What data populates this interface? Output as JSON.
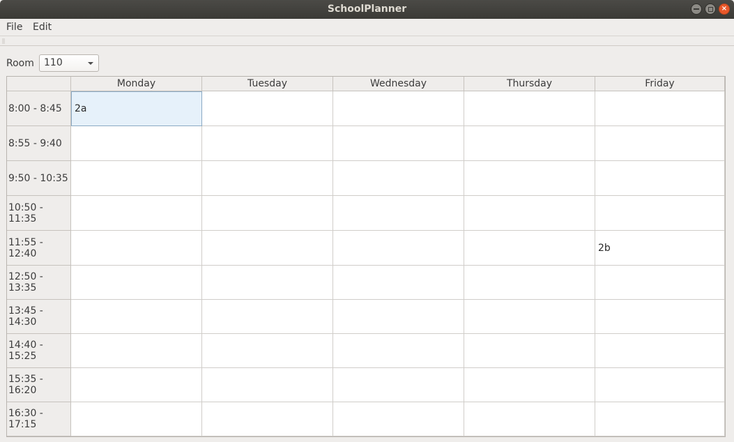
{
  "window": {
    "title": "SchoolPlanner",
    "minimize_glyph": "",
    "close_glyph": "×"
  },
  "menu": {
    "file": "File",
    "edit": "Edit"
  },
  "room": {
    "label": "Room",
    "selected": "110"
  },
  "schedule": {
    "days": [
      "Monday",
      "Tuesday",
      "Wednesday",
      "Thursday",
      "Friday"
    ],
    "times": [
      "8:00 - 8:45",
      "8:55 - 9:40",
      "9:50 - 10:35",
      "10:50 - 11:35",
      "11:55 - 12:40",
      "12:50 - 13:35",
      "13:45 - 14:30",
      "14:40 - 15:25",
      "15:35 - 16:20",
      "16:30 - 17:15"
    ],
    "cells": [
      [
        "2a",
        "",
        "",
        "",
        ""
      ],
      [
        "",
        "",
        "",
        "",
        ""
      ],
      [
        "",
        "",
        "",
        "",
        ""
      ],
      [
        "",
        "",
        "",
        "",
        ""
      ],
      [
        "",
        "",
        "",
        "",
        "2b"
      ],
      [
        "",
        "",
        "",
        "",
        ""
      ],
      [
        "",
        "",
        "",
        "",
        ""
      ],
      [
        "",
        "",
        "",
        "",
        ""
      ],
      [
        "",
        "",
        "",
        "",
        ""
      ],
      [
        "",
        "",
        "",
        "",
        ""
      ]
    ],
    "selected_cell": {
      "row": 0,
      "col": 0
    }
  },
  "colors": {
    "titlebar": "#3b3a36",
    "close_button": "#e9582a",
    "selection": "#e6f1fa"
  }
}
